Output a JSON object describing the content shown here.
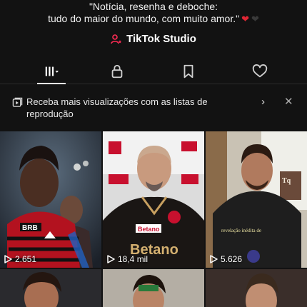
{
  "profile": {
    "bio_line1": "\"Notícia, resenha e deboche:",
    "bio_line2": "tudo do maior do mundo, com muito amor.\"",
    "studio_label": "TikTok Studio"
  },
  "tabs": [
    {
      "name": "videos",
      "icon": "grid-icon",
      "active": true
    },
    {
      "name": "private",
      "icon": "lock-icon",
      "active": false
    },
    {
      "name": "saved",
      "icon": "bookmark-icon",
      "active": false
    },
    {
      "name": "liked",
      "icon": "heart-icon",
      "active": false
    }
  ],
  "banner": {
    "text": "Receba mais visualizações com as listas de reprodução",
    "icon": "playlist-icon"
  },
  "videos": [
    {
      "views": "2.651",
      "caption": "",
      "badge": "BRB"
    },
    {
      "views": "18,4 mil",
      "caption": "",
      "badge": "Betano"
    },
    {
      "views": "5.626",
      "caption": "revelação inédita de",
      "badge": ""
    }
  ],
  "colors": {
    "background": "#121212",
    "heart_red": "#e02634",
    "flamengo_red": "#c8102e"
  }
}
